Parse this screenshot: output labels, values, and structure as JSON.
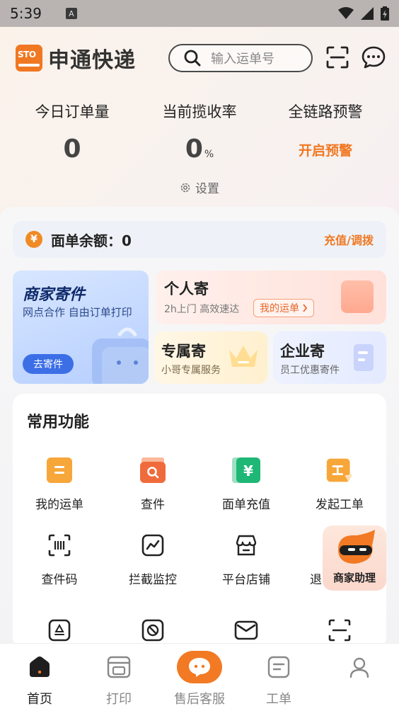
{
  "status_bar": {
    "time": "5:39",
    "app_badge": "A"
  },
  "header": {
    "brand_badge": "STO",
    "brand_name": "申通快递",
    "search_placeholder": "输入运单号"
  },
  "stats": [
    {
      "label": "今日订单量",
      "value": "0"
    },
    {
      "label": "当前揽收率",
      "value": "0",
      "unit": "%"
    },
    {
      "label": "全链路预警",
      "action": "开启预警"
    }
  ],
  "settings_label": "设置",
  "balance": {
    "coin": "¥",
    "label": "面单余额：0",
    "action": "充值/调拨"
  },
  "cards": {
    "merchant": {
      "title": "商家寄件",
      "subtitle": "网点合作 自由订单打印",
      "button": "去寄件"
    },
    "personal": {
      "title": "个人寄",
      "subtitle": "2h上门 高效速达",
      "pill": "我的运单"
    },
    "exclusive": {
      "title": "专属寄",
      "subtitle": "小哥专属服务"
    },
    "enterprise": {
      "title": "企业寄",
      "subtitle": "员工优惠寄件"
    }
  },
  "functions": {
    "title": "常用功能",
    "items": [
      {
        "label": "我的运单",
        "icon": "waybill-icon"
      },
      {
        "label": "查件",
        "icon": "search-parcel-icon"
      },
      {
        "label": "面单充值",
        "icon": "recharge-icon"
      },
      {
        "label": "发起工单",
        "icon": "ticket-icon"
      },
      {
        "label": "查件码",
        "icon": "scan-code-icon"
      },
      {
        "label": "拦截监控",
        "icon": "monitor-icon"
      },
      {
        "label": "平台店铺",
        "icon": "store-icon"
      },
      {
        "label": "退",
        "icon": "return-icon"
      }
    ]
  },
  "assistant_label": "商家助理",
  "tabs": [
    {
      "label": "首页",
      "active": true
    },
    {
      "label": "打印"
    },
    {
      "label": "售后客服"
    },
    {
      "label": "工单"
    },
    {
      "label": ""
    }
  ],
  "colors": {
    "brand": "#f07822",
    "accent_blue": "#3c6fe6"
  }
}
